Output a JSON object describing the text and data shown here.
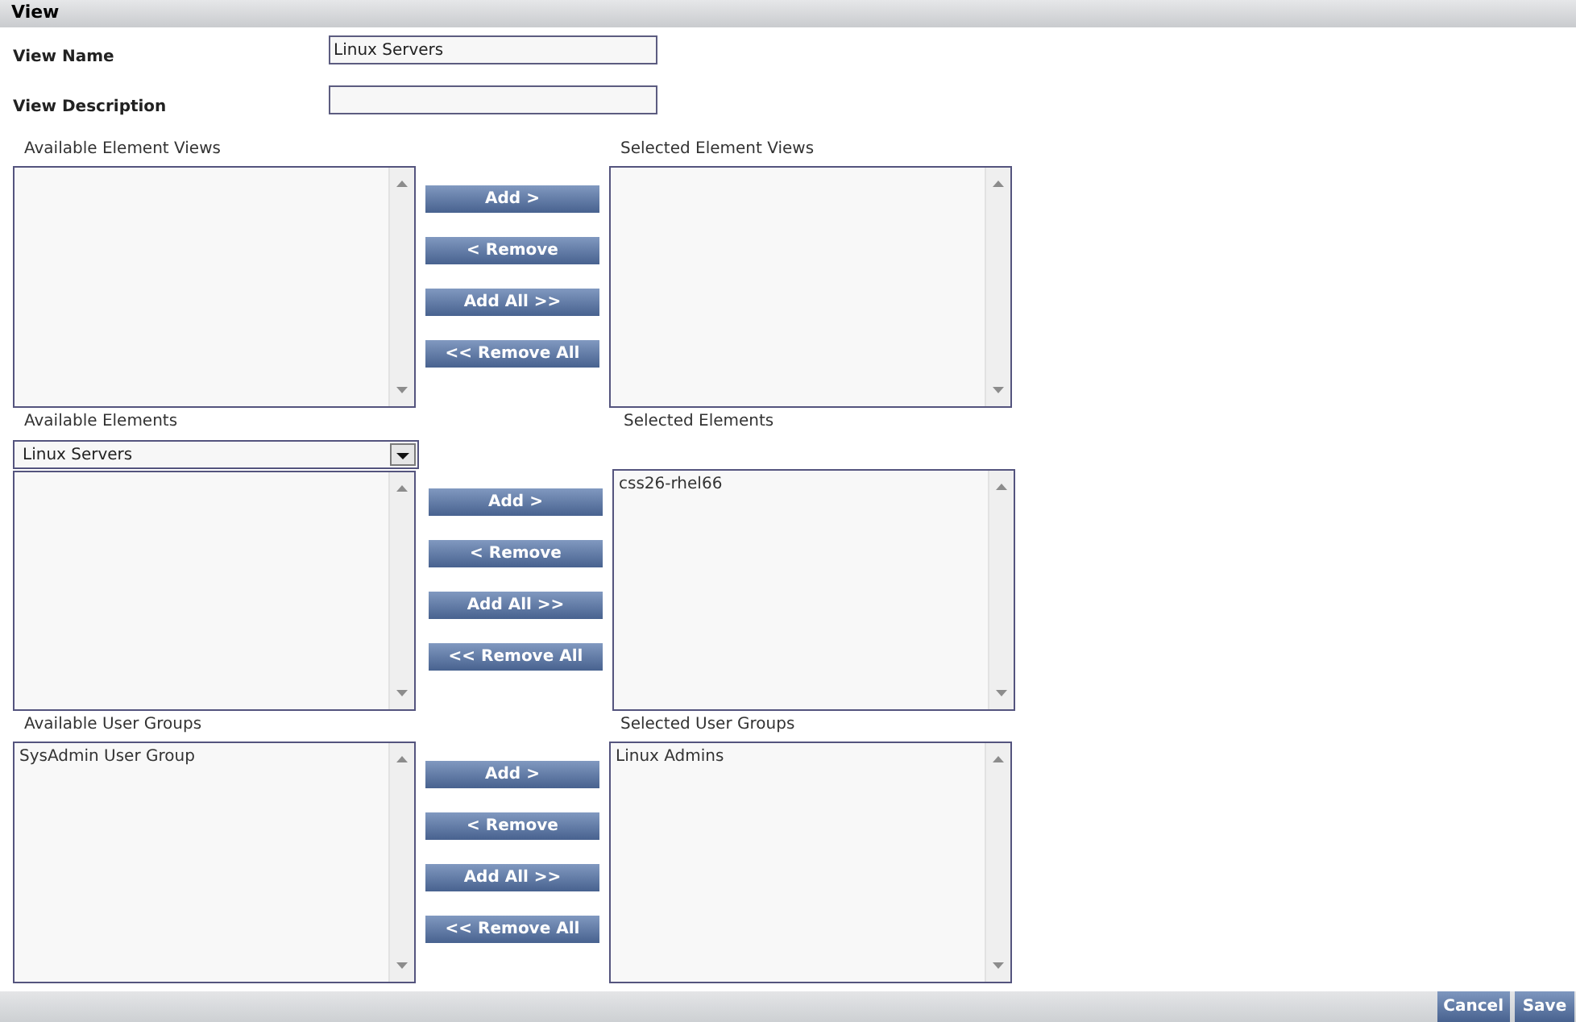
{
  "header": {
    "title": "View"
  },
  "fields": [
    {
      "label": "View Name",
      "value": "Linux Servers"
    },
    {
      "label": "View Description"
    }
  ],
  "sections": [
    {
      "available": {
        "label": "Available Element Views"
      },
      "selected": {
        "label": "Selected Element Views"
      },
      "buttons": [
        "Add >",
        "< Remove",
        "Add All >>",
        "<< Remove All"
      ]
    },
    {
      "available": {
        "label": "Available Elements",
        "dropdown": {
          "value": "Linux Servers"
        }
      },
      "selected": {
        "label": "Selected Elements",
        "items": [
          {
            "text": "css26-rhel66",
            "selected": false
          }
        ]
      },
      "buttons": [
        "Add >",
        "< Remove",
        "Add All >>",
        "<< Remove All"
      ]
    },
    {
      "available": {
        "label": "Available User Groups",
        "items": [
          {
            "text": "SysAdmin User Group",
            "selected": false
          }
        ]
      },
      "selected": {
        "label": "Selected User Groups",
        "items": [
          {
            "text": "Linux Admins",
            "selected": false
          }
        ]
      },
      "buttons": [
        "Add >",
        "< Remove",
        "Add All >>",
        "<< Remove All"
      ]
    }
  ],
  "footer": {
    "buttons": [
      "Cancel",
      "Save"
    ]
  }
}
